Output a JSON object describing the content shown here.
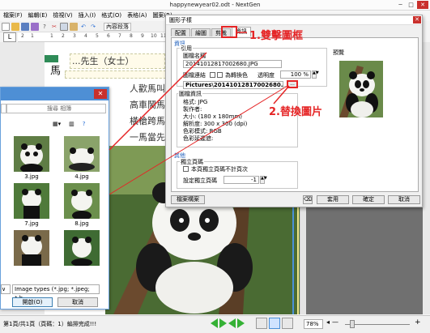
{
  "window": {
    "title": "happynewyear02.odt - NextGen",
    "minimize": "─",
    "maximize": "□",
    "close": "✕"
  },
  "menubar": {
    "items": [
      "檔案(F)",
      "編輯(E)",
      "檢視(V)",
      "插入(I)",
      "格式(O)",
      "表格(A)",
      "圖案(R)"
    ]
  },
  "toolbar": {
    "style_combo": "內容段落"
  },
  "ruler": {
    "ticks": [
      "2",
      "1",
      "",
      "1",
      "2",
      "3",
      "4",
      "5",
      "6",
      "7",
      "8",
      "9",
      "10",
      "11"
    ]
  },
  "document": {
    "label_text": "...先生（女士）",
    "big_char": "馬",
    "lines": [
      "人歡馬叫",
      "高車鬧馬",
      "橫槍跨馬",
      "一馬當先"
    ]
  },
  "file_dialog": {
    "close": "✕",
    "search_placeholder": "搜尋 相簿",
    "thumbs": [
      {
        "name": "3.jpg"
      },
      {
        "name": "4.jpg"
      },
      {
        "name": "7.jpg"
      },
      {
        "name": "8.jpg"
      },
      {
        "name": ""
      },
      {
        "name": ""
      }
    ],
    "filetype": "Image types (*.jpg; *.jpeg; *.b",
    "open_button": "開啟(O)",
    "cancel_button": "取消"
  },
  "prop_dialog": {
    "title": "圖形子樣",
    "close": "✕",
    "tabs": [
      "配置",
      "繪圖",
      "剪裁",
      "資訊"
    ],
    "active_tab": "資訊",
    "section_info": "資訊",
    "link_label": "引用",
    "filename_label": "圖檔名稱",
    "filename_value": "20141012817002680.JPG",
    "link_check_label": "圖檔連結",
    "fill_label": "為轉換色",
    "transparency_label": "透明度",
    "transparency_value": "100 %",
    "path_value": "Pictures\\20141012817002680.JPG",
    "browse_label": "...",
    "picinfo_label": "圖檔資訊",
    "format_line": "格式: JPG",
    "author_line": "製作者:",
    "size_line": "大小: (180 x 180mm)",
    "resolution_line": "解析度: 300 x 300 (dpi)",
    "color_line": "色彩模式: RGB",
    "compress_line": "色彩延遲遮:",
    "other_label": "其他",
    "standalone_label": "獨立頁碼",
    "standalone_check": "本頁獨立頁碼不計頁次",
    "setpage_label": "設定獨立頁碼",
    "setpage_value": "-1",
    "preview_label": "預覽",
    "bottom_left_btn": "檔案構案",
    "apply_btn": "套用",
    "ok_btn": "確定",
    "cancel_btn": "取消"
  },
  "annotations": {
    "step1": "1.雙擊圖框",
    "step2": "2.替換圖片",
    "color": "#e52526"
  },
  "statusbar": {
    "text": "第1頁/共1頁（頁碼：1）編排完成!!!",
    "zoom": "78%",
    "zoom_minus": "—",
    "zoom_plus": "+"
  }
}
